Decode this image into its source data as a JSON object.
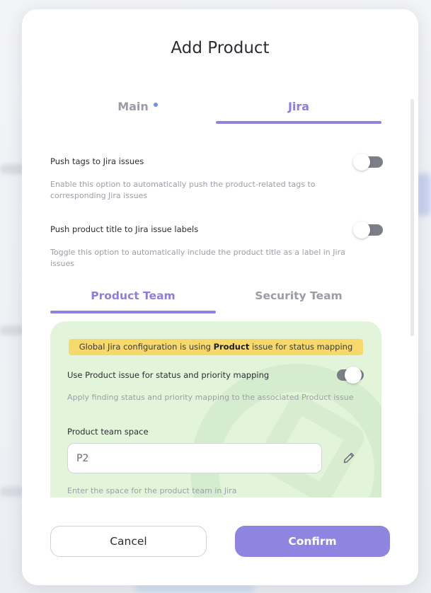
{
  "modal": {
    "title": "Add Product"
  },
  "tabs": {
    "main_label": "Main",
    "jira_label": "Jira",
    "active": "Jira"
  },
  "settings": {
    "push_tags": {
      "label": "Push tags to Jira issues",
      "description": "Enable this option to automatically push the product-related tags to corresponding Jira issues",
      "enabled": false
    },
    "push_title": {
      "label": "Push product title to Jira issue labels",
      "description": "Toggle this option to automatically include the product title as a label in Jira issues",
      "enabled": false
    }
  },
  "team_tabs": {
    "product_label": "Product Team",
    "security_label": "Security Team",
    "active": "Product Team"
  },
  "product_team": {
    "banner_prefix": "Global Jira configuration is using ",
    "banner_bold": "Product",
    "banner_suffix": " issue for status mapping",
    "use_issue": {
      "label": "Use Product issue for status and priority mapping",
      "description": "Apply finding status and priority mapping to the associated Product issue",
      "enabled": false
    },
    "space": {
      "label": "Product team space",
      "value": "P2",
      "placeholder": "",
      "helper": "Enter the space for the product team in Jira"
    },
    "edit_icon": "pencil-icon"
  },
  "footer": {
    "cancel_label": "Cancel",
    "confirm_label": "Confirm"
  },
  "colors": {
    "accent": "#8f82de",
    "panel_bg": "#e2f5da",
    "banner_bg": "#f7d96b",
    "toggle_off": "#7b7e89"
  }
}
